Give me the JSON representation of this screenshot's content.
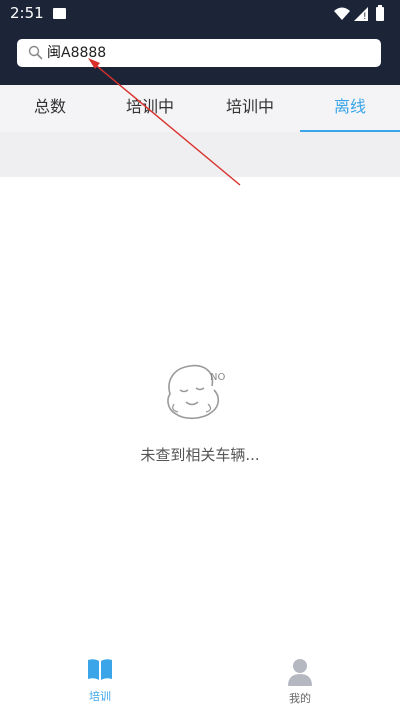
{
  "status_bar": {
    "time": "2:51",
    "icons": [
      "image-icon",
      "wifi-icon",
      "signal-icon",
      "battery-icon"
    ]
  },
  "search": {
    "value": "闽A8888",
    "icon": "search-icon"
  },
  "tabs": [
    {
      "label": "总数",
      "active": false
    },
    {
      "label": "培训中",
      "active": false
    },
    {
      "label": "培训中",
      "active": false
    },
    {
      "label": "离线",
      "active": true
    }
  ],
  "empty_state": {
    "badge": "NO",
    "message": "未查到相关车辆..."
  },
  "bottom_nav": [
    {
      "label": "培训",
      "icon": "book-icon",
      "active": true
    },
    {
      "label": "我的",
      "icon": "person-icon",
      "active": false
    }
  ],
  "colors": {
    "header_bg": "#1c2438",
    "accent": "#3aa5e8",
    "annotation_arrow": "#d9302a"
  }
}
